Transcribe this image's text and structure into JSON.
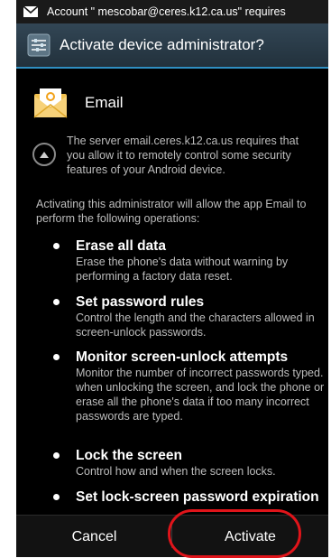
{
  "status_bar": {
    "notification_text": "Account \" mescobar@ceres.k12.ca.us\" requires",
    "icon": "mail-icon"
  },
  "title_bar": {
    "title": "Activate device administrator?",
    "icon": "settings-icon",
    "accent_color": "#2f8fc2"
  },
  "app": {
    "name": "Email",
    "icon": "email-icon"
  },
  "server_message": "The server email.ceres.k12.ca.us requires that you allow it to remotely control some security features of your Android device.",
  "intro": "Activating this administrator will allow the app Email to perform the following operations:",
  "permissions": [
    {
      "title": "Erase all data",
      "description": "Erase the phone's data without warning by performing a factory data reset."
    },
    {
      "title": "Set password rules",
      "description": "Control the length and the characters allowed in screen-unlock passwords."
    },
    {
      "title": "Monitor screen-unlock attempts",
      "description": "Monitor the number of incorrect passwords typed. when unlocking the screen, and lock the phone or erase all the phone's data if too many incorrect passwords are typed."
    },
    {
      "title": "Lock the screen",
      "description": "Control how and when the screen locks."
    },
    {
      "title": "Set lock-screen password expiration",
      "description": ""
    }
  ],
  "buttons": {
    "cancel": "Cancel",
    "activate": "Activate"
  },
  "annotation_color": "#e0141a"
}
